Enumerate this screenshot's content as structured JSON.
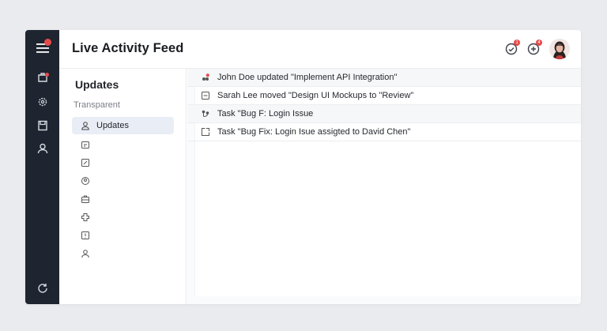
{
  "header": {
    "title": "Live Activity Feed",
    "icons": [
      {
        "name": "activity-sync-icon",
        "badge": "1"
      },
      {
        "name": "notification-sync-icon",
        "badge": "4"
      }
    ]
  },
  "sidebar": {
    "title": "Updates",
    "subtitle": "Transparent",
    "items": [
      {
        "label": "Updates",
        "icon": "user-icon",
        "active": true
      },
      {
        "label": "",
        "icon": "calendar-icon"
      },
      {
        "label": "",
        "icon": "edit-icon"
      },
      {
        "label": "",
        "icon": "contact-icon"
      },
      {
        "label": "",
        "icon": "briefcase-icon"
      },
      {
        "label": "",
        "icon": "puzzle-icon"
      },
      {
        "label": "",
        "icon": "alert-icon"
      },
      {
        "label": "",
        "icon": "person-icon"
      }
    ]
  },
  "feed": {
    "items": [
      {
        "text": "John Doe updated \"Implement API Integration\"",
        "icon": "team-icon"
      },
      {
        "text": "Sarah Lee moved \"Design UI Mockups to \"Review\"",
        "icon": "card-icon"
      },
      {
        "text": "Task \"Bug F: Login Issue",
        "icon": "branch-icon"
      },
      {
        "text": "Task \"Bug Fix: Login Isue assigted to David Chen\"",
        "icon": "assign-icon"
      }
    ]
  },
  "colors": {
    "rail": "#1e2430",
    "accent": "#e74a4a",
    "active_item": "#e9edf5"
  }
}
